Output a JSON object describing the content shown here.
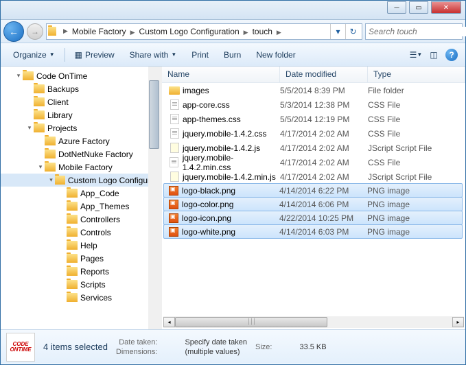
{
  "breadcrumb": [
    "Mobile Factory",
    "Custom Logo Configuration",
    "touch"
  ],
  "search": {
    "placeholder": "Search touch"
  },
  "toolbar": {
    "organize": "Organize",
    "preview": "Preview",
    "share": "Share with",
    "print": "Print",
    "burn": "Burn",
    "newfolder": "New folder"
  },
  "tree": [
    {
      "indent": 0,
      "toggle": "▾",
      "label": "Code OnTime"
    },
    {
      "indent": 1,
      "toggle": "",
      "label": "Backups"
    },
    {
      "indent": 1,
      "toggle": "",
      "label": "Client"
    },
    {
      "indent": 1,
      "toggle": "",
      "label": "Library"
    },
    {
      "indent": 1,
      "toggle": "▾",
      "label": "Projects"
    },
    {
      "indent": 2,
      "toggle": "",
      "label": "Azure Factory"
    },
    {
      "indent": 2,
      "toggle": "",
      "label": "DotNetNuke Factory"
    },
    {
      "indent": 2,
      "toggle": "▾",
      "label": "Mobile Factory"
    },
    {
      "indent": 3,
      "toggle": "▾",
      "label": "Custom Logo Configurat",
      "selected": true
    },
    {
      "indent": 4,
      "toggle": "",
      "label": "App_Code"
    },
    {
      "indent": 4,
      "toggle": "",
      "label": "App_Themes"
    },
    {
      "indent": 4,
      "toggle": "",
      "label": "Controllers"
    },
    {
      "indent": 4,
      "toggle": "",
      "label": "Controls"
    },
    {
      "indent": 4,
      "toggle": "",
      "label": "Help"
    },
    {
      "indent": 4,
      "toggle": "",
      "label": "Pages"
    },
    {
      "indent": 4,
      "toggle": "",
      "label": "Reports"
    },
    {
      "indent": 4,
      "toggle": "",
      "label": "Scripts"
    },
    {
      "indent": 4,
      "toggle": "",
      "label": "Services"
    }
  ],
  "columns": {
    "name": "Name",
    "date": "Date modified",
    "type": "Type"
  },
  "files": [
    {
      "icon": "folder",
      "name": "images",
      "date": "5/5/2014 8:39 PM",
      "type": "File folder",
      "selected": false
    },
    {
      "icon": "css",
      "name": "app-core.css",
      "date": "5/3/2014 12:38 PM",
      "type": "CSS File",
      "selected": false
    },
    {
      "icon": "css",
      "name": "app-themes.css",
      "date": "5/5/2014 12:19 PM",
      "type": "CSS File",
      "selected": false
    },
    {
      "icon": "css",
      "name": "jquery.mobile-1.4.2.css",
      "date": "4/17/2014 2:02 AM",
      "type": "CSS File",
      "selected": false
    },
    {
      "icon": "js",
      "name": "jquery.mobile-1.4.2.js",
      "date": "4/17/2014 2:02 AM",
      "type": "JScript Script File",
      "selected": false
    },
    {
      "icon": "css",
      "name": "jquery.mobile-1.4.2.min.css",
      "date": "4/17/2014 2:02 AM",
      "type": "CSS File",
      "selected": false
    },
    {
      "icon": "js",
      "name": "jquery.mobile-1.4.2.min.js",
      "date": "4/17/2014 2:02 AM",
      "type": "JScript Script File",
      "selected": false
    },
    {
      "icon": "png",
      "name": "logo-black.png",
      "date": "4/14/2014 6:22 PM",
      "type": "PNG image",
      "selected": true
    },
    {
      "icon": "png",
      "name": "logo-color.png",
      "date": "4/14/2014 6:06 PM",
      "type": "PNG image",
      "selected": true
    },
    {
      "icon": "png",
      "name": "logo-icon.png",
      "date": "4/22/2014 10:25 PM",
      "type": "PNG image",
      "selected": true
    },
    {
      "icon": "png",
      "name": "logo-white.png",
      "date": "4/14/2014 6:03 PM",
      "type": "PNG image",
      "selected": true
    }
  ],
  "details": {
    "title": "4 items selected",
    "datetaken_label": "Date taken:",
    "datetaken_val": "Specify date taken",
    "dimensions_label": "Dimensions:",
    "dimensions_val": "(multiple values)",
    "size_label": "Size:",
    "size_val": "33.5 KB",
    "thumb_text": "CODE ONTIME"
  }
}
